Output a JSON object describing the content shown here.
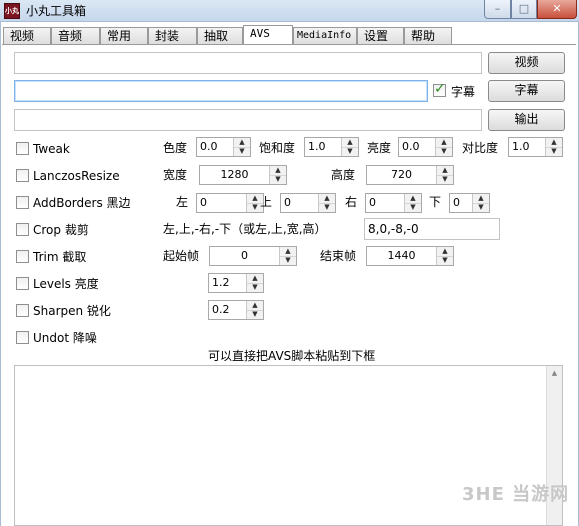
{
  "window": {
    "title": "小丸工具箱",
    "icon_label": "小丸"
  },
  "tabs": [
    "视频",
    "音频",
    "常用",
    "封装",
    "抽取",
    "AVS",
    "MediaInfo",
    "设置",
    "帮助"
  ],
  "active_tab": "AVS",
  "io": {
    "video_button": "视频",
    "subtitle_button": "字幕",
    "output_button": "输出",
    "subtitle_checkbox_label": "字幕",
    "subtitle_checked": true,
    "video_path": "",
    "subtitle_path": "",
    "output_path": ""
  },
  "filters": {
    "tweak": {
      "label": "Tweak",
      "hue_label": "色度",
      "hue": "0.0",
      "saturation_label": "饱和度",
      "saturation": "1.0",
      "brightness_label": "亮度",
      "brightness": "0.0",
      "contrast_label": "对比度",
      "contrast": "1.0"
    },
    "lanczos": {
      "label": "LanczosResize",
      "width_label": "宽度",
      "width": "1280",
      "height_label": "高度",
      "height": "720"
    },
    "addborders": {
      "label": "AddBorders 黑边",
      "left_label": "左",
      "left": "0",
      "top_label": "上",
      "top": "0",
      "right_label": "右",
      "right": "0",
      "bottom_label": "下",
      "bottom": "0"
    },
    "crop": {
      "label": "Crop 裁剪",
      "hint": "左,上,-右,-下（或左,上,宽,高）",
      "value": "8,0,-8,-0"
    },
    "trim": {
      "label": "Trim 截取",
      "start_label": "起始帧",
      "start": "0",
      "end_label": "结束帧",
      "end": "1440"
    },
    "levels": {
      "label": "Levels 亮度",
      "value": "1.2"
    },
    "sharpen": {
      "label": "Sharpen 锐化",
      "value": "0.2"
    },
    "undot": {
      "label": "Undot 降噪"
    }
  },
  "script": {
    "hint": "可以直接把AVS脚本粘贴到下框",
    "text": ""
  },
  "watermark": "3HE 当游网"
}
